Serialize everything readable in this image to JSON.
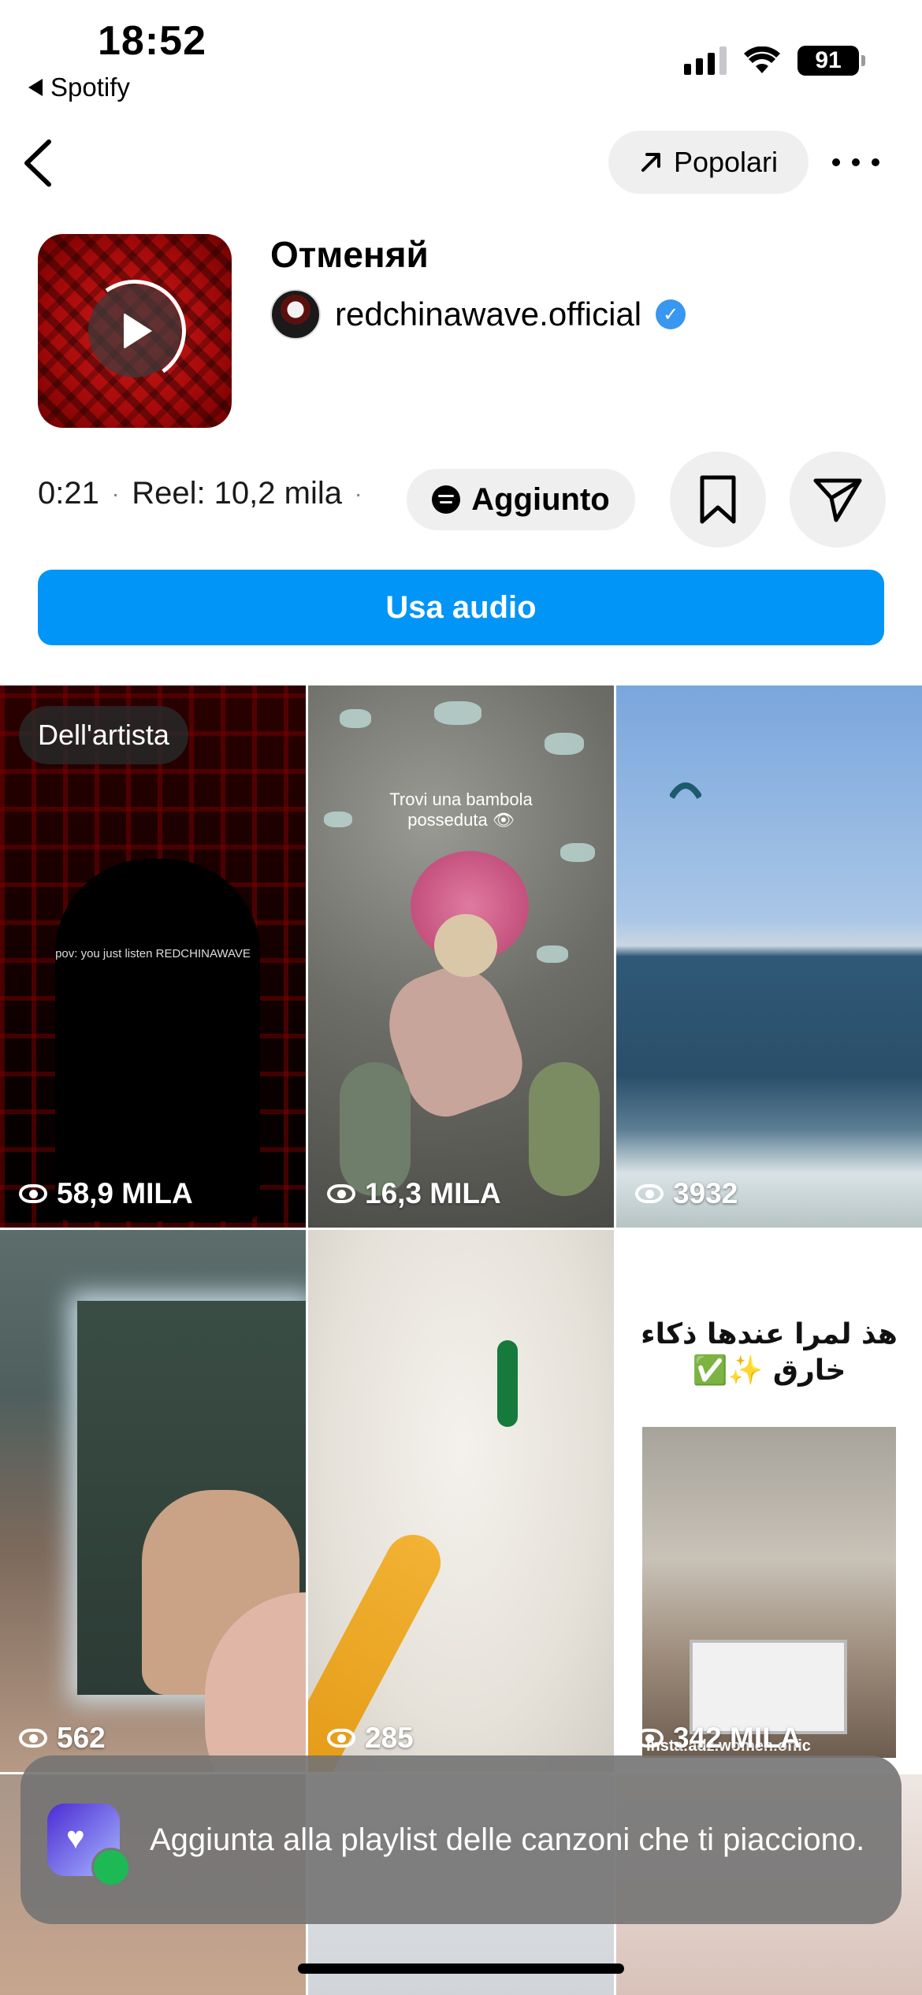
{
  "status_bar": {
    "time": "18:52",
    "back_app": "Spotify",
    "battery": "91"
  },
  "header": {
    "popular_label": "Popolari"
  },
  "audio": {
    "title": "Отменяй",
    "artist": "redchinawave.official",
    "duration": "0:21",
    "reels_count": "Reel: 10,2 mila",
    "added_label": "Aggiunto",
    "use_audio_label": "Usa audio"
  },
  "grid": {
    "artist_badge": "Dell'artista",
    "tiles": [
      {
        "views": "58,9 MILA",
        "caption": "pov: you just listen REDCHINAWAVE"
      },
      {
        "views": "16,3 MILA",
        "caption": "Trovi una bambola posseduta 👁"
      },
      {
        "views": "3932"
      },
      {
        "views": "562"
      },
      {
        "views": "285"
      },
      {
        "views": "342 MILA",
        "caption": "هذ لمرا عندها ذكاء خارق ✨✅",
        "watermark": "insta:adz.women.offic"
      }
    ]
  },
  "toast": {
    "message": "Aggiunta alla playlist delle canzoni che ti piacciono."
  },
  "colors": {
    "primary_button": "#0095f6",
    "verified": "#3897f0",
    "pill_bg": "#efefef",
    "toast_bg": "#737373"
  },
  "icons": [
    "back-chevron-icon",
    "trend-arrow-icon",
    "more-icon",
    "play-icon",
    "verified-icon",
    "spotify-icon",
    "bookmark-icon",
    "send-icon",
    "eye-icon"
  ]
}
